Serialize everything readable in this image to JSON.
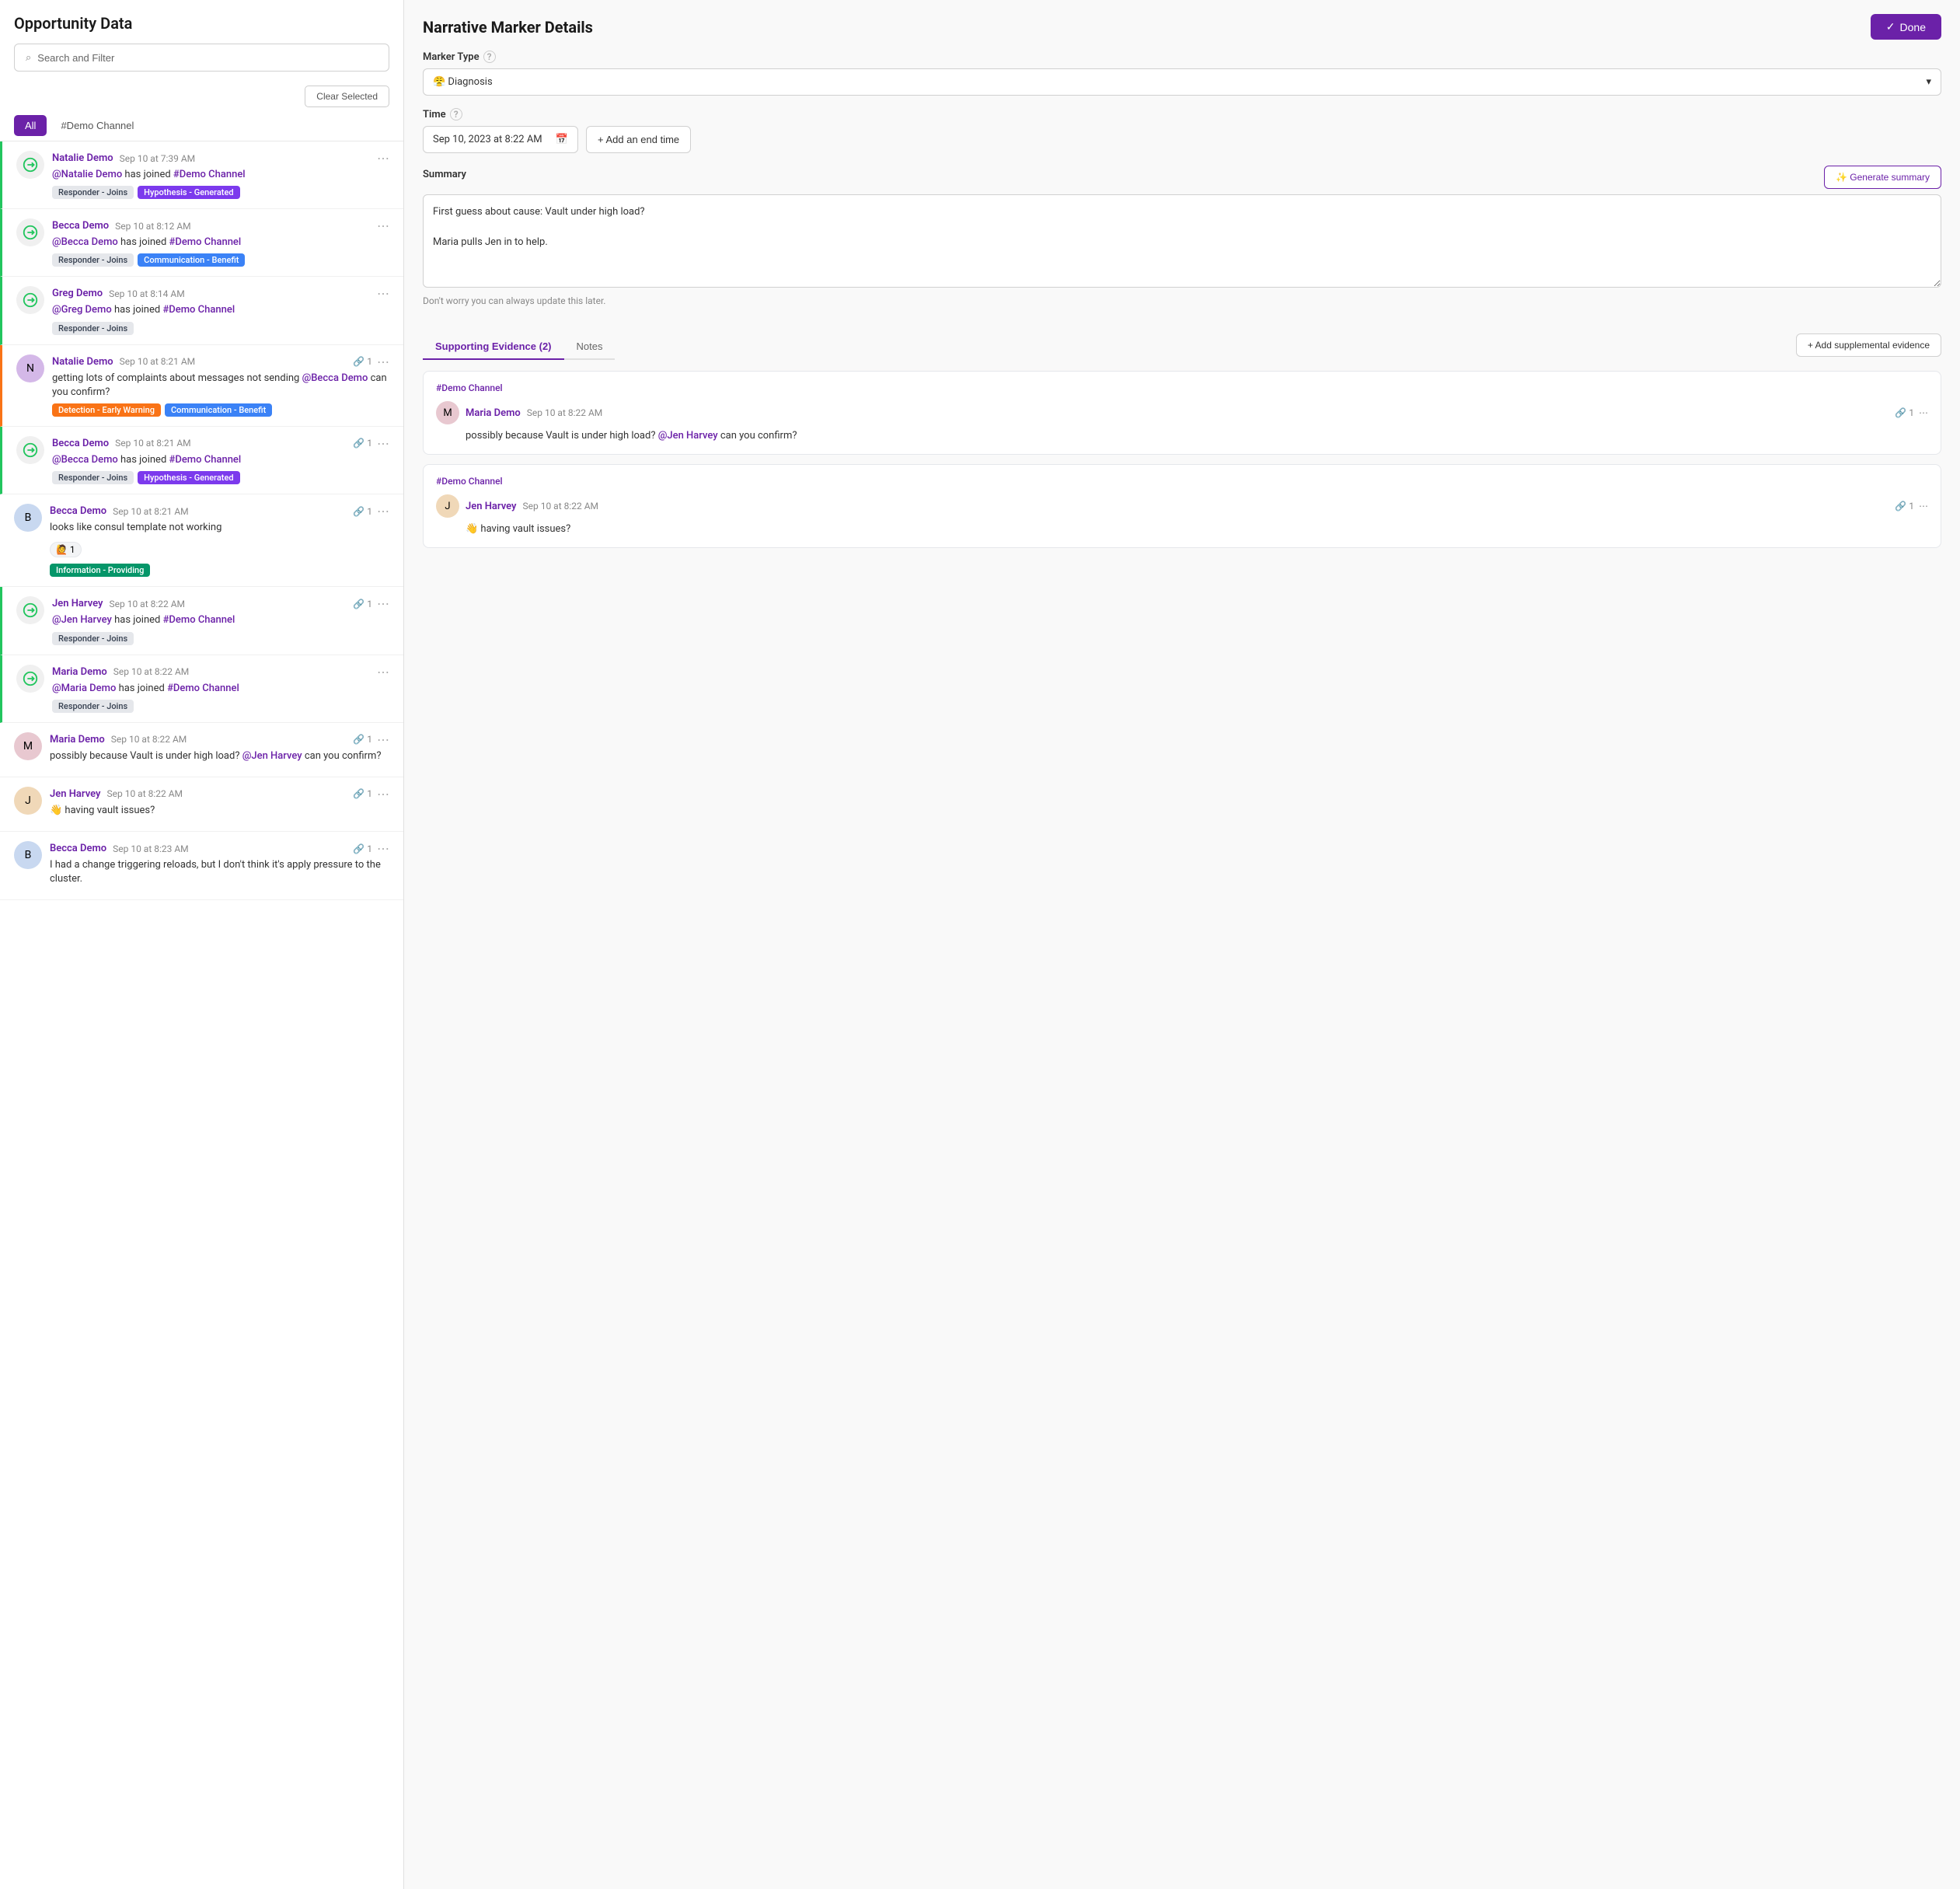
{
  "left": {
    "title": "Opportunity Data",
    "search_placeholder": "Search and Filter",
    "clear_selected": "Clear Selected",
    "tabs": [
      {
        "label": "All",
        "active": true
      },
      {
        "label": "#Demo Channel",
        "active": false
      }
    ],
    "messages": [
      {
        "id": "m1",
        "user": "Natalie Demo",
        "time": "Sep 10 at 7:39 AM",
        "text": "@Natalie Demo has joined #Demo Channel",
        "tags": [
          {
            "label": "Responder - Joins",
            "style": "gray"
          },
          {
            "label": "Hypothesis - Generated",
            "style": "purple"
          }
        ],
        "responder": true,
        "link_count": null
      },
      {
        "id": "m2",
        "user": "Becca Demo",
        "time": "Sep 10 at 8:12 AM",
        "text": "@Becca Demo has joined #Demo Channel",
        "tags": [
          {
            "label": "Responder - Joins",
            "style": "gray"
          },
          {
            "label": "Communication - Benefit",
            "style": "blue"
          }
        ],
        "responder": true,
        "link_count": null
      },
      {
        "id": "m3",
        "user": "Greg Demo",
        "time": "Sep 10 at 8:14 AM",
        "text": "@Greg Demo has joined #Demo Channel",
        "tags": [
          {
            "label": "Responder - Joins",
            "style": "gray"
          }
        ],
        "responder": true,
        "link_count": null
      },
      {
        "id": "m4",
        "user": "Natalie Demo",
        "time": "Sep 10 at 8:21 AM",
        "text": "getting lots of complaints about messages not sending @Becca Demo can you confirm?",
        "tags": [
          {
            "label": "Detection - Early Warning",
            "style": "orange"
          },
          {
            "label": "Communication - Benefit",
            "style": "blue"
          }
        ],
        "responder": false,
        "link_count": "1",
        "avatar_class": "avatar-natalie",
        "avatar_letter": "N"
      },
      {
        "id": "m5",
        "user": "Becca Demo",
        "time": "Sep 10 at 8:21 AM",
        "text": "@Becca Demo has joined #Demo Channel",
        "tags": [
          {
            "label": "Responder - Joins",
            "style": "gray"
          },
          {
            "label": "Hypothesis - Generated",
            "style": "purple"
          }
        ],
        "responder": true,
        "link_count": "1"
      },
      {
        "id": "m6",
        "user": "Becca Demo",
        "time": "Sep 10 at 8:21 AM",
        "text": "looks like consul template not working",
        "emoji": "🙋",
        "emoji_count": "1",
        "tags": [
          {
            "label": "Information - Providing",
            "style": "green"
          }
        ],
        "responder": false,
        "link_count": "1",
        "avatar_class": "avatar-becca",
        "avatar_letter": "B"
      },
      {
        "id": "m7",
        "user": "Jen Harvey",
        "time": "Sep 10 at 8:22 AM",
        "text": "@Jen Harvey has joined #Demo Channel",
        "tags": [
          {
            "label": "Responder - Joins",
            "style": "gray"
          }
        ],
        "responder": true,
        "link_count": "1"
      },
      {
        "id": "m8",
        "user": "Maria Demo",
        "time": "Sep 10 at 8:22 AM",
        "text": "@Maria Demo has joined #Demo Channel",
        "tags": [
          {
            "label": "Responder - Joins",
            "style": "gray"
          }
        ],
        "responder": true,
        "link_count": null
      },
      {
        "id": "m9",
        "user": "Maria Demo",
        "time": "Sep 10 at 8:22 AM",
        "text": "possibly because Vault is under high load? @Jen Harvey can you confirm?",
        "tags": [],
        "responder": false,
        "link_count": "1",
        "avatar_class": "avatar-maria",
        "avatar_letter": "M"
      },
      {
        "id": "m10",
        "user": "Jen Harvey",
        "time": "Sep 10 at 8:22 AM",
        "text": "👋 having vault issues?",
        "tags": [],
        "responder": false,
        "link_count": "1",
        "avatar_class": "avatar-jen",
        "avatar_letter": "J"
      },
      {
        "id": "m11",
        "user": "Becca Demo",
        "time": "Sep 10 at 8:23 AM",
        "text": "I had a change triggering reloads, but I don't think it's apply pressure to the cluster.",
        "tags": [],
        "responder": false,
        "link_count": "1",
        "avatar_class": "avatar-becca",
        "avatar_letter": "B"
      }
    ]
  },
  "right": {
    "title": "Narrative Marker Details",
    "done_label": "Done",
    "marker_type_label": "Marker Type",
    "marker_type_value": "😤 Diagnosis",
    "time_label": "Time",
    "time_value": "Sep 10, 2023 at 8:22 AM",
    "add_end_time_label": "+ Add an end time",
    "summary_label": "Summary",
    "generate_summary_label": "✨ Generate summary",
    "summary_text": "First guess about cause: Vault under high load?\n\nMaria pulls Jen in to help.",
    "summary_hint": "Don't worry you can always update this later.",
    "evidence_tabs": [
      {
        "label": "Supporting Evidence (2)",
        "active": true
      },
      {
        "label": "Notes",
        "active": false
      }
    ],
    "add_evidence_label": "+ Add supplemental evidence",
    "evidence_cards": [
      {
        "channel": "#Demo Channel",
        "user": "Maria Demo",
        "time": "Sep 10 at 8:22 AM",
        "text": "possibly because Vault is under high load? @Jen Harvey can you confirm?",
        "link_count": "1",
        "avatar_class": "avatar-maria",
        "avatar_letter": "M"
      },
      {
        "channel": "#Demo Channel",
        "user": "Jen Harvey",
        "time": "Sep 10 at 8:22 AM",
        "text": "👋 having vault issues?",
        "link_count": "1",
        "avatar_class": "avatar-jen",
        "avatar_letter": "J"
      }
    ]
  }
}
